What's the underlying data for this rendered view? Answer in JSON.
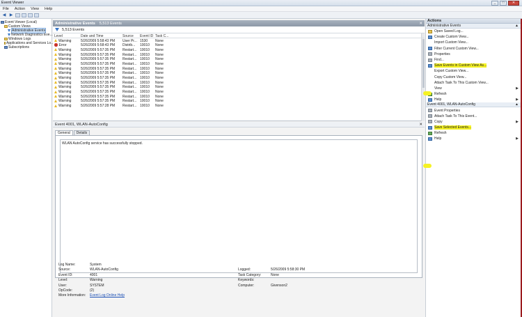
{
  "window": {
    "title": "Event Viewer",
    "controls": [
      "_",
      "□",
      "✕"
    ]
  },
  "menu": [
    "File",
    "Action",
    "View",
    "Help"
  ],
  "tree": [
    {
      "label": "Event Viewer (Local)",
      "icon": "book-icon",
      "indent": 0
    },
    {
      "label": "Custom Views",
      "icon": "folder-icon",
      "indent": 1
    },
    {
      "label": "Administrative Events",
      "icon": "funnel-icon",
      "indent": 2,
      "selected": true
    },
    {
      "label": "Network Diagnostics Eve...",
      "icon": "funnel-icon",
      "indent": 2
    },
    {
      "label": "Windows Logs",
      "icon": "folder-icon",
      "indent": 1
    },
    {
      "label": "Applications and Services Lo...",
      "icon": "folder-icon",
      "indent": 1
    },
    {
      "label": "Subscriptions",
      "icon": "book-icon",
      "indent": 1
    }
  ],
  "header": {
    "title": "Administrative Events",
    "count": "5,513 Events",
    "close": "✕"
  },
  "filter": {
    "count": "5,513 Events"
  },
  "columns": [
    "Level",
    "Date and Time",
    "Source",
    "Event ID",
    "Task C..."
  ],
  "rows": [
    {
      "level": "Warning",
      "date": "5/26/2009 5:58:43 PM",
      "source": "User Pr...",
      "id": "1530",
      "task": "None",
      "type": "warn"
    },
    {
      "level": "Error",
      "date": "5/26/2009 5:58:43 PM",
      "source": "Distrib...",
      "id": "10010",
      "task": "None",
      "type": "err"
    },
    {
      "level": "Warning",
      "date": "5/26/2009 5:57:35 PM",
      "source": "Restart...",
      "id": "10010",
      "task": "None",
      "type": "warn"
    },
    {
      "level": "Warning",
      "date": "5/26/2009 5:57:35 PM",
      "source": "Restart...",
      "id": "10010",
      "task": "None",
      "type": "warn"
    },
    {
      "level": "Warning",
      "date": "5/26/2009 5:57:35 PM",
      "source": "Restart...",
      "id": "10010",
      "task": "None",
      "type": "warn"
    },
    {
      "level": "Warning",
      "date": "5/26/2009 5:57:35 PM",
      "source": "Restart...",
      "id": "10010",
      "task": "None",
      "type": "warn"
    },
    {
      "level": "Warning",
      "date": "5/26/2009 5:57:35 PM",
      "source": "Restart...",
      "id": "10010",
      "task": "None",
      "type": "warn"
    },
    {
      "level": "Warning",
      "date": "5/26/2009 5:57:35 PM",
      "source": "Restart...",
      "id": "10010",
      "task": "None",
      "type": "warn"
    },
    {
      "level": "Warning",
      "date": "5/26/2009 5:57:35 PM",
      "source": "Restart...",
      "id": "10010",
      "task": "None",
      "type": "warn"
    },
    {
      "level": "Warning",
      "date": "5/26/2009 5:57:35 PM",
      "source": "Restart...",
      "id": "10010",
      "task": "None",
      "type": "warn"
    },
    {
      "level": "Warning",
      "date": "5/26/2009 5:57:35 PM",
      "source": "Restart...",
      "id": "10010",
      "task": "None",
      "type": "warn"
    },
    {
      "level": "Warning",
      "date": "5/26/2009 5:57:35 PM",
      "source": "Restart...",
      "id": "10010",
      "task": "None",
      "type": "warn"
    },
    {
      "level": "Warning",
      "date": "5/26/2009 5:57:35 PM",
      "source": "Restart...",
      "id": "10010",
      "task": "None",
      "type": "warn"
    },
    {
      "level": "Warning",
      "date": "5/26/2009 5:57:35 PM",
      "source": "Restart...",
      "id": "10010",
      "task": "None",
      "type": "warn"
    },
    {
      "level": "Warning",
      "date": "5/26/2009 5:57:28 PM",
      "source": "Restart...",
      "id": "10010",
      "task": "None",
      "type": "warn"
    }
  ],
  "detail": {
    "title": "Event 4001, WLAN-AutoConfig",
    "close": "✕",
    "tabs": [
      "General",
      "Details"
    ],
    "message": "WLAN AutoConfig service has successfully stopped.",
    "props": [
      {
        "k1": "Log Name:",
        "v1": "System",
        "k2": "",
        "v2": ""
      },
      {
        "k1": "Source:",
        "v1": "WLAN-AutoConfig",
        "k2": "Logged:",
        "v2": "5/26/2009 5:58:30 PM"
      },
      {
        "k1": "Event ID:",
        "v1": "4001",
        "k2": "Task Category:",
        "v2": "None"
      },
      {
        "k1": "Level:",
        "v1": "Warning",
        "k2": "Keywords:",
        "v2": ""
      },
      {
        "k1": "User:",
        "v1": "SYSTEM",
        "k2": "Computer:",
        "v2": "Givenson2"
      },
      {
        "k1": "OpCode:",
        "v1": "(2)",
        "k2": "",
        "v2": ""
      },
      {
        "k1": "More Information:",
        "v1": "Event Log Online Help",
        "k2": "",
        "v2": "",
        "link": true
      }
    ]
  },
  "actions": {
    "title": "Actions",
    "section1": "Administrative Events",
    "items1": [
      {
        "label": "Open Saved Log...",
        "icon": "gold"
      },
      {
        "label": "Create Custom View...",
        "icon": "blue"
      },
      {
        "label": "Import Custom View...",
        "icon": "none"
      },
      {
        "label": "Filter Current Custom View...",
        "icon": "blue"
      },
      {
        "label": "Properties",
        "icon": "grey"
      },
      {
        "label": "Find...",
        "icon": "grey"
      },
      {
        "label": "Save Events in Custom View As...",
        "icon": "blue",
        "highlight": true
      },
      {
        "label": "Export Custom View...",
        "icon": "none"
      },
      {
        "label": "Copy Custom View...",
        "icon": "none"
      },
      {
        "label": "Attach Task To This Custom View...",
        "icon": "none"
      },
      {
        "label": "View",
        "icon": "none",
        "arrow": true
      },
      {
        "label": "Refresh",
        "icon": "green"
      },
      {
        "label": "Help",
        "icon": "blue",
        "arrow": true
      }
    ],
    "section2": "Event 4001, WLAN-AutoConfig",
    "items2": [
      {
        "label": "Event Properties",
        "icon": "grey"
      },
      {
        "label": "Attach Task To This Event...",
        "icon": "grey"
      },
      {
        "label": "Copy",
        "icon": "grey",
        "arrow": true
      },
      {
        "label": "Save Selected Events...",
        "icon": "blue",
        "highlight": true
      },
      {
        "label": "Refresh",
        "icon": "green"
      },
      {
        "label": "Help",
        "icon": "blue",
        "arrow": true
      }
    ]
  }
}
